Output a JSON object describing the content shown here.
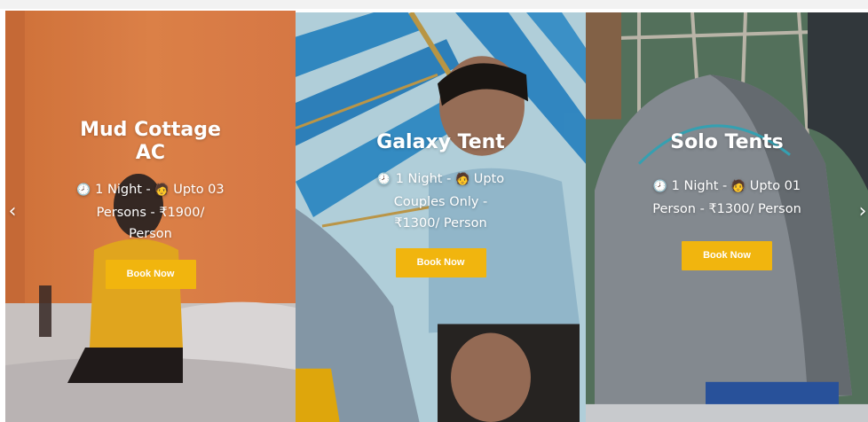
{
  "cards": [
    {
      "title": "Mud Cottage AC",
      "info_prefix": "1 Night - ",
      "info_suffix": " Upto 03 Persons - ₹1900/ Person",
      "button": "Book Now"
    },
    {
      "title": "Galaxy Tent",
      "info_prefix": "1 Night - ",
      "info_suffix": " Upto Couples Only - ₹1300/ Person",
      "button": "Book Now"
    },
    {
      "title": "Solo Tents",
      "info_prefix": "1 Night - ",
      "info_suffix": " Upto 01 Person - ₹1300/ Person",
      "button": "Book Now"
    }
  ],
  "icons": {
    "clock": "🕗",
    "person": "🧑"
  },
  "carousel": {
    "prev": "‹",
    "next": "›"
  },
  "colors": {
    "button": "#f1b50e",
    "card1_wall": "#e9874c"
  }
}
